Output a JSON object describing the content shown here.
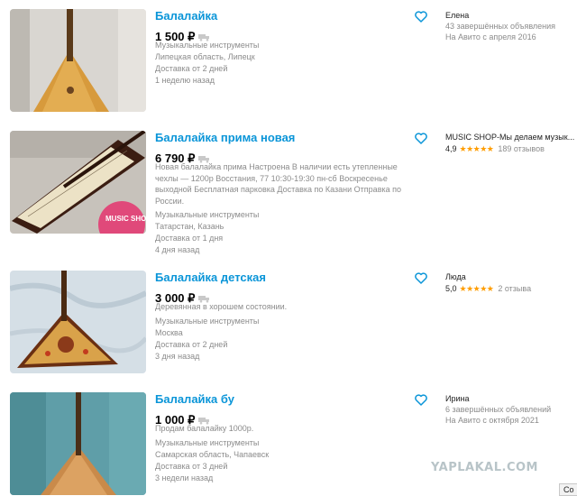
{
  "listings": [
    {
      "title": "Балалайка",
      "price": "1 500 ₽",
      "description": "",
      "category": "Музыкальные инструменты",
      "location": "Липецкая область, Липецк",
      "delivery": "Доставка от 2 дней",
      "posted": "1 неделю назад",
      "seller": {
        "name": "Елена",
        "line1": "43 завершённых объявления",
        "line2": "На Авито с апреля 2016",
        "rating": "",
        "stars": "",
        "reviews": ""
      }
    },
    {
      "title": "Балалайка прима новая",
      "price": "6 790 ₽",
      "description": "Новая балалайка прима Настроена В наличии есть утепленные чехлы — 1200р Восстания, 77 10:30-19:30 пн-сб Воскресенье выходной Бесплатная парковка Доставка по Казани Отправка по России.",
      "category": "Музыкальные инструменты",
      "location": "Татарстан, Казань",
      "delivery": "Доставка от 1 дня",
      "posted": "4 дня назад",
      "seller": {
        "name": "MUSIC SHOP-Мы делаем музык...",
        "line1": "",
        "line2": "",
        "rating": "4,9",
        "stars": "★★★★★",
        "reviews": "189 отзывов"
      },
      "badge": "MUSIC SHOP"
    },
    {
      "title": "Балалайка детская",
      "price": "3 000 ₽",
      "description": "Деревянная в хорошем состоянии.",
      "category": "Музыкальные инструменты",
      "location": "Москва",
      "delivery": "Доставка от 2 дней",
      "posted": "3 дня назад",
      "seller": {
        "name": "Люда",
        "line1": "",
        "line2": "",
        "rating": "5,0",
        "stars": "★★★★★",
        "reviews": "2 отзыва"
      }
    },
    {
      "title": "Балалайка бу",
      "price": "1 000 ₽",
      "description": "Продам балалайку 1000р.",
      "category": "Музыкальные инструменты",
      "location": "Самарская область, Чапаевск",
      "delivery": "Доставка от 3 дней",
      "posted": "3 недели назад",
      "seller": {
        "name": "Ирина",
        "line1": "6 завершённых объявлений",
        "line2": "На Авито с октября 2021",
        "rating": "",
        "stars": "",
        "reviews": ""
      }
    }
  ],
  "icons": {
    "favorite": "heart-outline-icon",
    "delivery": "truck-icon"
  },
  "colors": {
    "title": "#0a95d8",
    "muted": "#8b8b8b",
    "star": "#ff9d00",
    "watermark": "#b8c4c8"
  },
  "watermark": "YAPLAKAL.COM",
  "corner_button": "Co"
}
